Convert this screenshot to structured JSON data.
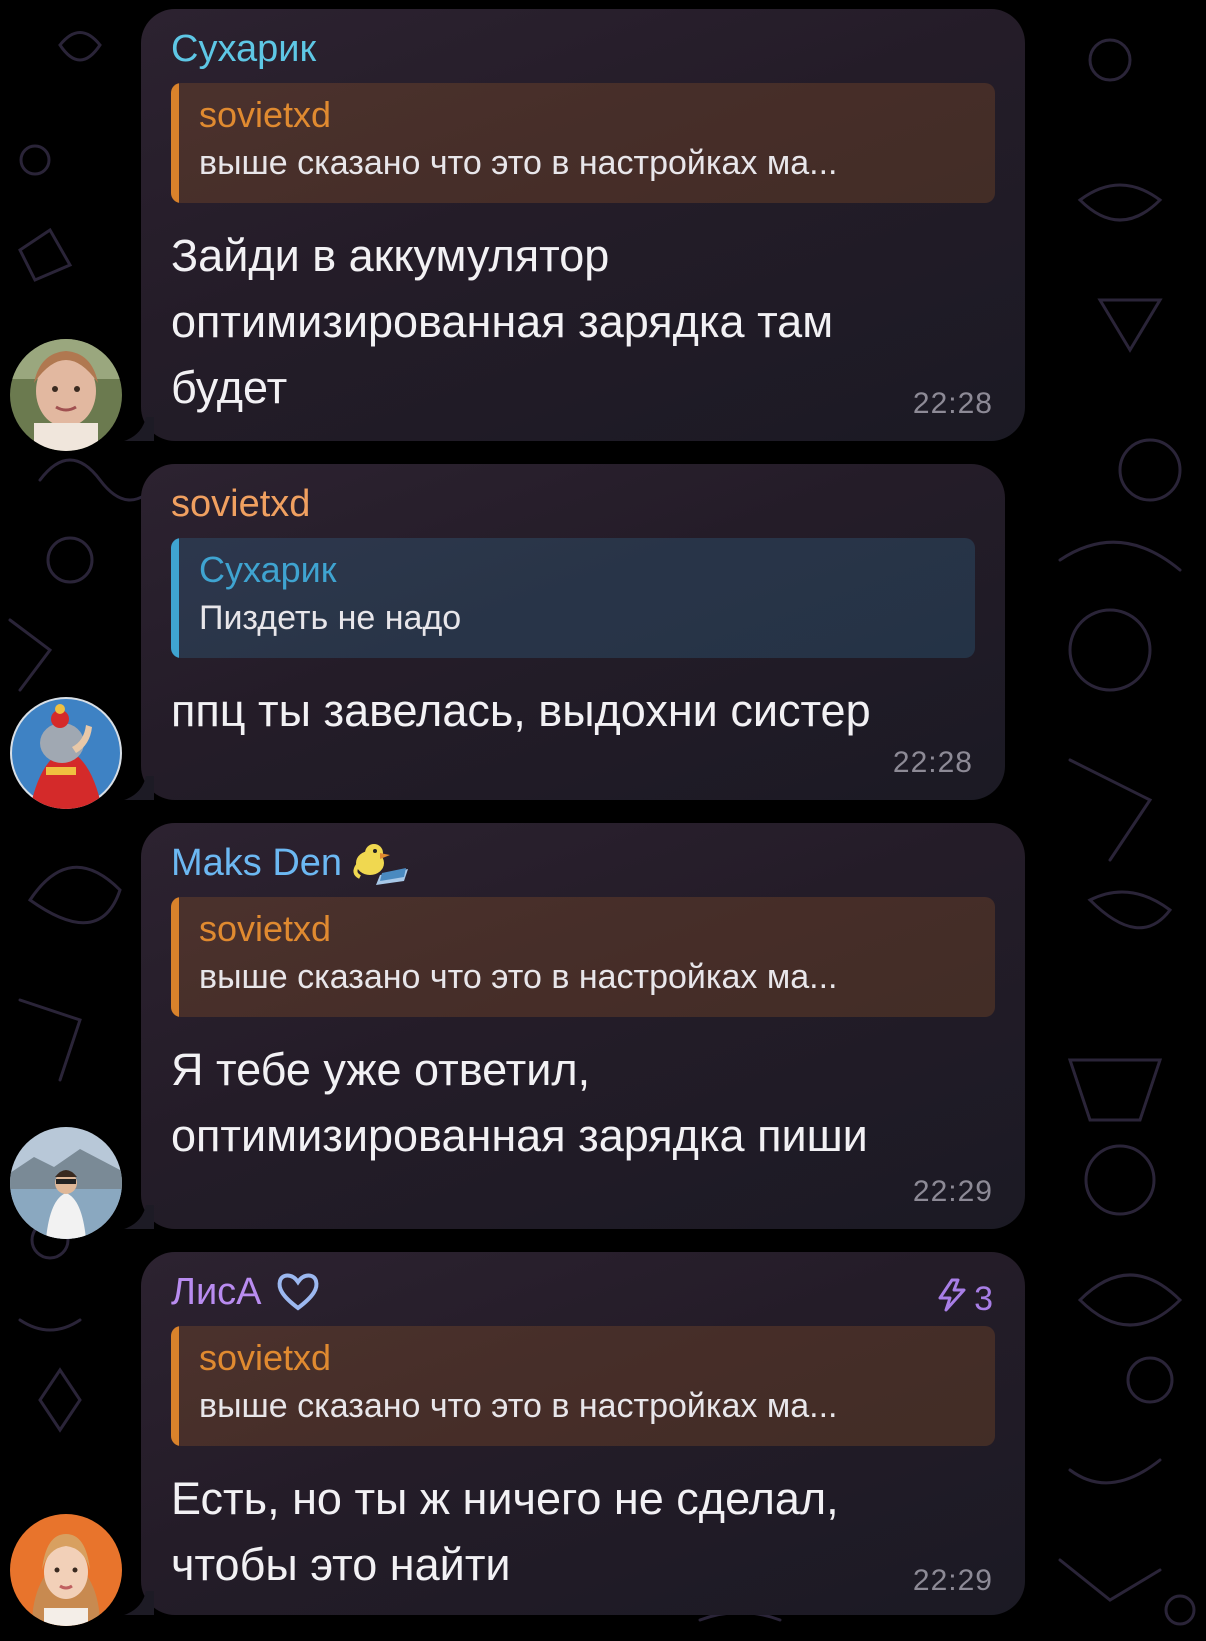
{
  "messages": [
    {
      "sender": "Сухарик",
      "sender_color": "#5ec7e5",
      "reply_to": {
        "name": "sovietxd",
        "text": "выше сказано что это в настройках ма..."
      },
      "text": [
        "Зайди в аккумулятор",
        "оптимизированная зарядка там",
        "будет"
      ],
      "time": "22:28"
    },
    {
      "sender": "sovietxd",
      "sender_color": "#f0a060",
      "reply_to": {
        "name": "Сухарик",
        "text": "Пиздеть не надо"
      },
      "text": [
        "ппц ты завелась, выдохни систер"
      ],
      "time": "22:28"
    },
    {
      "sender": "Maks Den",
      "sender_color": "#6cb8f2",
      "reply_to": {
        "name": "sovietxd",
        "text": "выше сказано что это в настройках ма..."
      },
      "text": [
        "Я тебе уже ответил,",
        "оптимизированная зарядка пиши"
      ],
      "time": "22:29"
    },
    {
      "sender": "ЛисА",
      "sender_color": "#b98cf0",
      "boost_count": "3",
      "reply_to": {
        "name": "sovietxd",
        "text": "выше сказано что это в настройках ма..."
      },
      "text": [
        "Есть, но ты ж ничего не сделал,",
        "чтобы это найти"
      ],
      "time": "22:29"
    }
  ],
  "colors": {
    "orange_reply_name": "#e08a30",
    "blue_reply_name": "#3fa4d1",
    "time": "#8d8a96",
    "boost": "#a87ee6"
  },
  "icons": {
    "sender_1_emoji": "cartoon-duck-laptop-icon",
    "sender_3_badge": "heart-outline-icon",
    "boost": "boost-lightning-icon"
  }
}
